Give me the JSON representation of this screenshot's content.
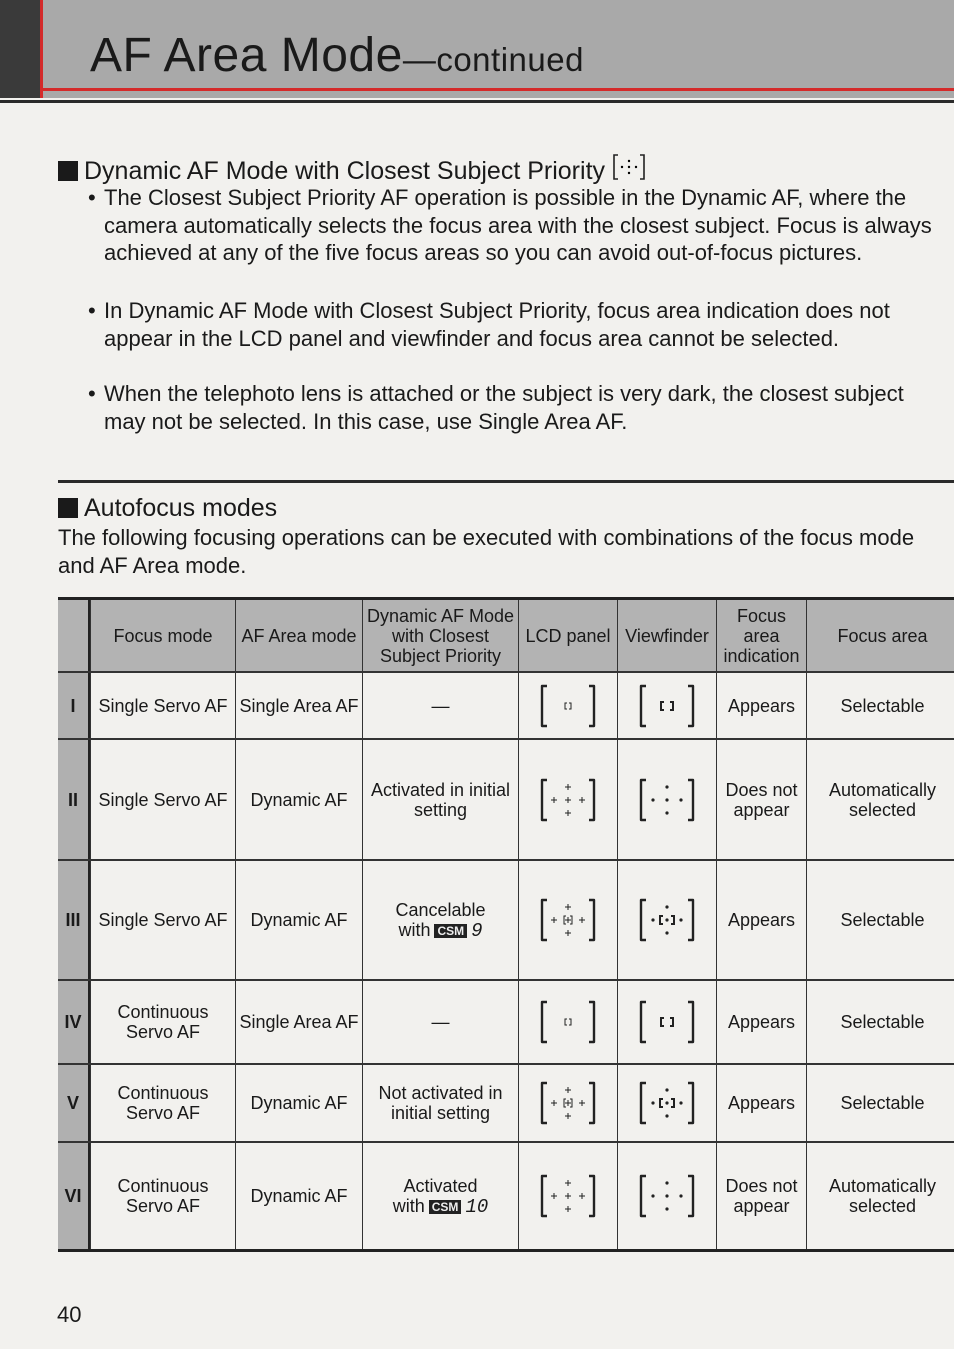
{
  "header": {
    "title": "AF Area Mode",
    "subtitle": "—continued",
    "accent_color": "#d42a2a"
  },
  "section1": {
    "heading": "Dynamic AF Mode with Closest Subject Priority",
    "heading_icon": "dynamic-closest-subject-icon",
    "bullets": [
      "The Closest Subject Priority AF operation is possible in the Dynamic AF, where the camera automatically selects the focus area with the closest subject. Focus is always achieved at any of the five focus areas so you can avoid out-of-focus pictures.",
      "In Dynamic AF Mode with Closest Subject Priority, focus area indication does not appear in the LCD panel and viewfinder and focus area cannot be selected.",
      "When the telephoto lens is attached or the subject is very dark, the closest subject may not be selected. In this case, use Single Area AF."
    ]
  },
  "section2": {
    "heading": "Autofocus modes",
    "text": "The following focusing operations can be executed with combinations of the focus mode and AF Area mode."
  },
  "table": {
    "headers": [
      "",
      "Focus mode",
      "AF Area mode",
      "Dynamic AF Mode with Closest Subject Priority",
      "LCD panel",
      "Viewfinder",
      "Focus area indication",
      "Focus area"
    ],
    "rows": [
      {
        "id": "I",
        "focus_mode": "Single Servo AF",
        "af_area": "Single Area AF",
        "closest": "—",
        "closest_csm": "",
        "lcd_icon": "single",
        "vf_icon": "single",
        "indication": "Appears",
        "focus_area": "Selectable"
      },
      {
        "id": "II",
        "focus_mode": "Single Servo AF",
        "af_area": "Dynamic AF",
        "closest": "Activated in initial setting",
        "closest_csm": "",
        "lcd_icon": "dynamic",
        "vf_icon": "dynamic",
        "indication": "Does not appear",
        "focus_area": "Automatically selected"
      },
      {
        "id": "III",
        "focus_mode": "Single Servo AF",
        "af_area": "Dynamic AF",
        "closest": "Cancelable with",
        "closest_csm": "CSM",
        "closest_csm_num": "9",
        "lcd_icon": "dynamic-center",
        "vf_icon": "dynamic-center",
        "indication": "Appears",
        "focus_area": "Selectable"
      },
      {
        "id": "IV",
        "focus_mode": "Continuous Servo AF",
        "af_area": "Single Area AF",
        "closest": "—",
        "closest_csm": "",
        "lcd_icon": "single",
        "vf_icon": "single",
        "indication": "Appears",
        "focus_area": "Selectable"
      },
      {
        "id": "V",
        "focus_mode": "Continuous Servo AF",
        "af_area": "Dynamic AF",
        "closest": "Not activated in initial setting",
        "closest_csm": "",
        "lcd_icon": "dynamic-center",
        "vf_icon": "dynamic-center",
        "indication": "Appears",
        "focus_area": "Selectable"
      },
      {
        "id": "VI",
        "focus_mode": "Continuous Servo AF",
        "af_area": "Dynamic AF",
        "closest": "Activated with",
        "closest_csm": "CSM",
        "closest_csm_num": "10",
        "lcd_icon": "dynamic",
        "vf_icon": "dynamic",
        "indication": "Does not appear",
        "focus_area": "Automatically selected"
      }
    ]
  },
  "page_number": "40"
}
